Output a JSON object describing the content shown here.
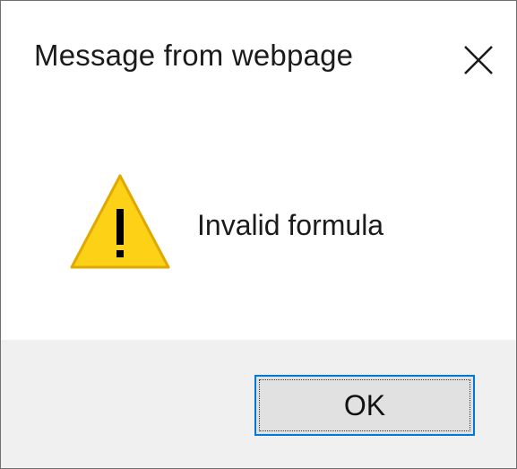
{
  "dialog": {
    "title": "Message from webpage",
    "message": "Invalid formula",
    "icon": "warning-icon",
    "close_icon": "close-icon",
    "button_ok_label": "OK"
  },
  "colors": {
    "warning_fill": "#fcd116",
    "warning_stroke": "#e0a800",
    "focus_border": "#0078d7",
    "footer_bg": "#f0f0f0"
  }
}
